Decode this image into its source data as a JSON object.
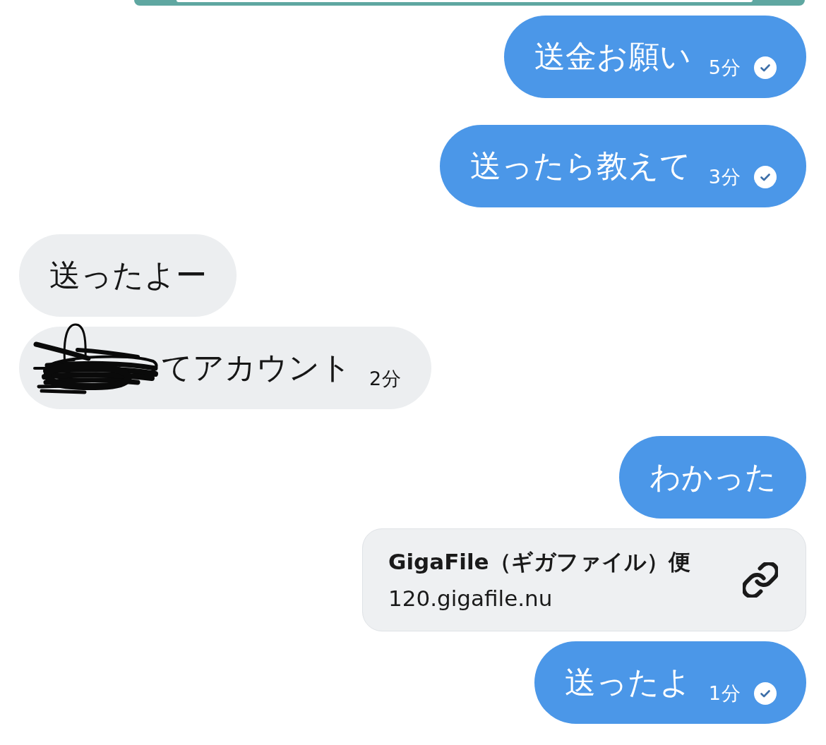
{
  "messages": [
    {
      "kind": "cut_off"
    },
    {
      "kind": "text",
      "outgoing": true,
      "text": "送金お願い",
      "time": "5分",
      "read": true,
      "redacted": false
    },
    {
      "kind": "text",
      "outgoing": true,
      "text": "送ったら教えて",
      "time": "3分",
      "read": true,
      "redacted": false
    },
    {
      "kind": "text",
      "outgoing": false,
      "text": "送ったよー",
      "read": false,
      "redacted": false
    },
    {
      "kind": "text",
      "outgoing": false,
      "text": "てアカウント",
      "time": "2分",
      "read": false,
      "redacted": true
    },
    {
      "kind": "text",
      "outgoing": true,
      "text": "わかった",
      "read": false,
      "redacted": false
    },
    {
      "kind": "link",
      "outgoing": true,
      "title": "GigaFile（ギガファイル）便",
      "url": "120.gigafile.nu"
    },
    {
      "kind": "text",
      "outgoing": true,
      "text": "送ったよ",
      "time": "1分",
      "read": true,
      "redacted": false
    }
  ]
}
